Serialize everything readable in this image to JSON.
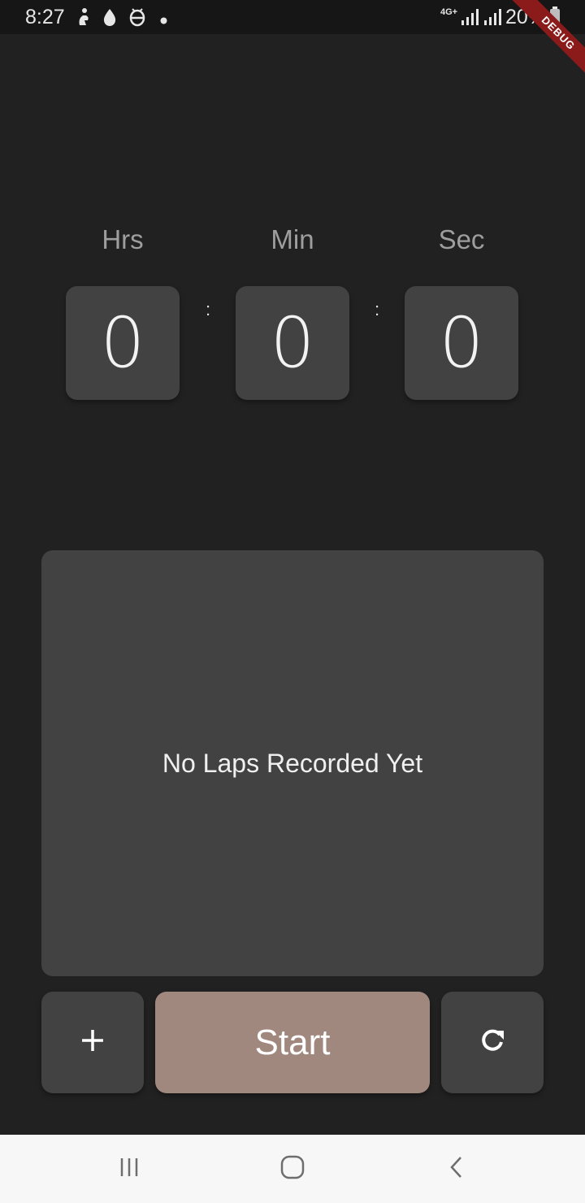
{
  "status_bar": {
    "time": "8:27",
    "network": "4G+",
    "battery": "20%",
    "icons": [
      "figure-icon",
      "drop-icon",
      "debug-bug-icon",
      "dot-icon",
      "signal-icon",
      "signal-icon",
      "battery-icon"
    ]
  },
  "debug_banner": "DEBUG",
  "timer": {
    "labels": {
      "hours": "Hrs",
      "minutes": "Min",
      "seconds": "Sec"
    },
    "values": {
      "hours": "0",
      "minutes": "0",
      "seconds": "0"
    },
    "separator": ":"
  },
  "laps": {
    "empty_message": "No Laps Recorded Yet"
  },
  "controls": {
    "lap_icon": "plus-icon",
    "start_label": "Start",
    "reset_icon": "refresh-icon",
    "start_color": "#a1887f"
  },
  "nav_bar": {
    "icons": [
      "recent-apps-icon",
      "home-icon",
      "back-icon"
    ]
  }
}
